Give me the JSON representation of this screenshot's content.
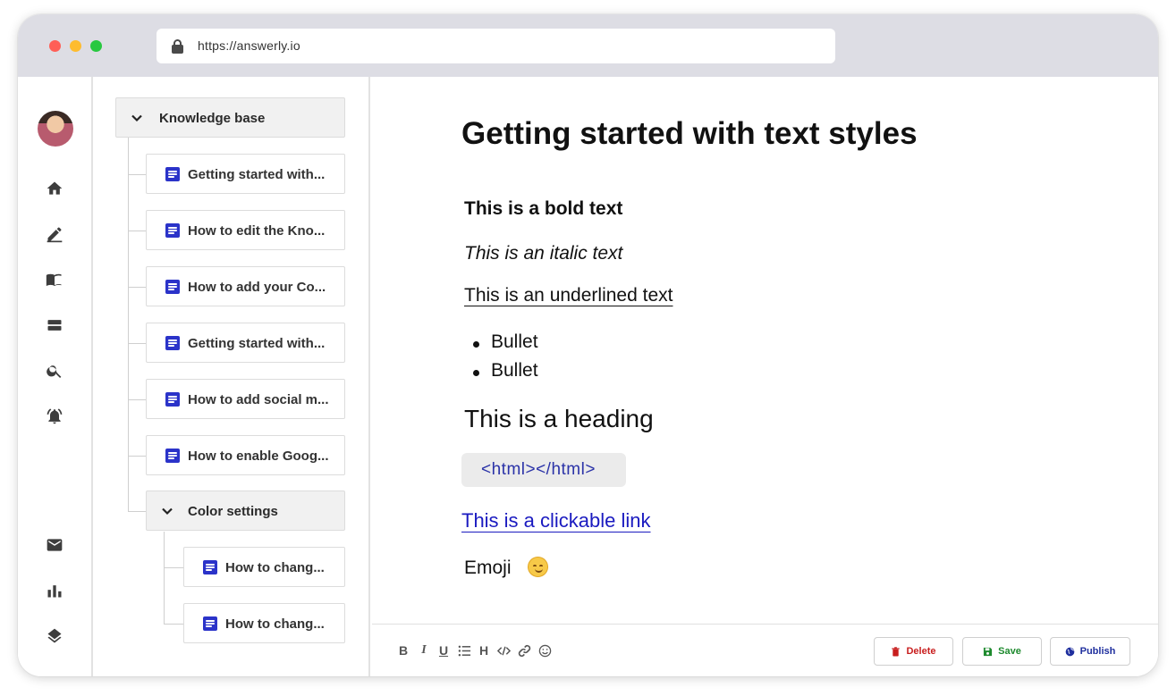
{
  "browser": {
    "url": "https://answerly.io"
  },
  "tree": {
    "root": {
      "label": "Knowledge base"
    },
    "items": [
      {
        "label": "Getting started with..."
      },
      {
        "label": "How to edit the Kno..."
      },
      {
        "label": "How to add your Co..."
      },
      {
        "label": "Getting started with..."
      },
      {
        "label": "How to add social m..."
      },
      {
        "label": "How to enable Goog..."
      }
    ],
    "subfolder": {
      "label": "Color settings",
      "items": [
        {
          "label": "How to chang..."
        },
        {
          "label": "How to chang..."
        }
      ]
    }
  },
  "editor": {
    "title": "Getting started with text styles",
    "bold_text": "This is a bold text",
    "italic_text": "This is an italic text",
    "underline_text": "This is an underlined text",
    "bullets": [
      "Bullet",
      "Bullet"
    ],
    "heading": "This is a heading",
    "code": "<html></html>",
    "link": "This is a clickable link",
    "emoji_label": "Emoji"
  },
  "toolbar": {
    "bold": "B",
    "italic": "I",
    "underline": "U",
    "heading": "H",
    "delete_label": "Delete",
    "save_label": "Save",
    "publish_label": "Publish"
  },
  "colors": {
    "accent_blue": "#2b33c9",
    "link": "#1a1ac0",
    "delete": "#c81e1e",
    "save": "#1e8a2e",
    "publish": "#1f2f9e"
  }
}
